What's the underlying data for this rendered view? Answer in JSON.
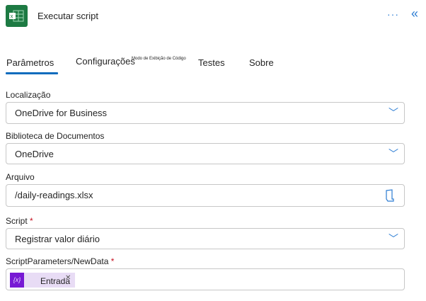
{
  "header": {
    "title": "Executar script",
    "more_icon": "ellipsis-icon",
    "collapse_icon": "double-chevron-left-icon"
  },
  "tabs": [
    {
      "label": "Parâmetros",
      "active": true
    },
    {
      "label": "Configurações"
    },
    {
      "label": "Testes"
    },
    {
      "label": "Sobre"
    }
  ],
  "code_view_label": "Modo de Exibição de Código",
  "fields": {
    "location": {
      "label": "Localização",
      "value": "OneDrive for Business"
    },
    "library": {
      "label": "Biblioteca de Documentos",
      "value": "OneDrive"
    },
    "file": {
      "label": "Arquivo",
      "value": "/daily-readings.xlsx"
    },
    "script": {
      "label": "Script",
      "required": "*",
      "value": "Registrar valor diário"
    },
    "newdata": {
      "label": "ScriptParameters/NewData",
      "required": "*",
      "token": "Entrada",
      "token_icon": "{x}"
    }
  }
}
